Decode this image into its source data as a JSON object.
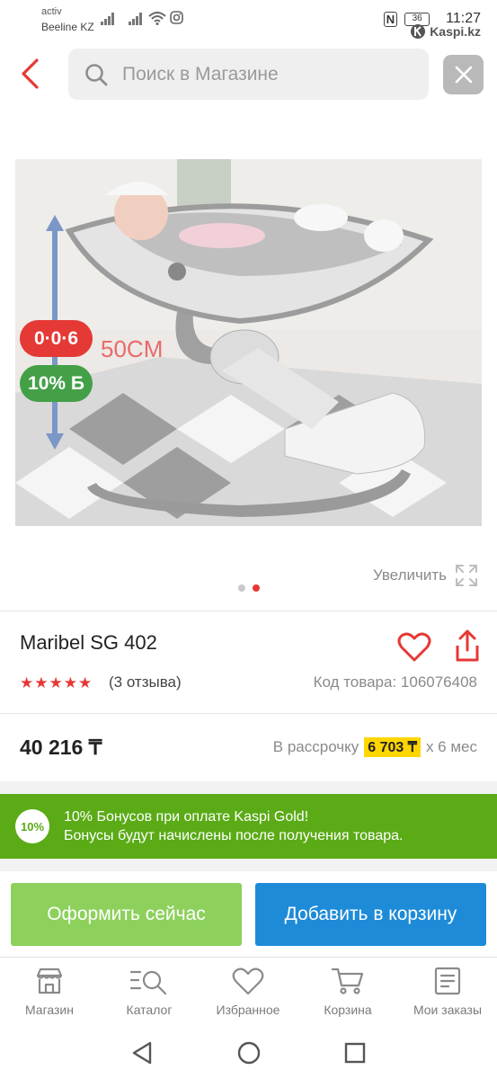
{
  "status_bar": {
    "carrier_line1": "activ",
    "carrier_line2": "Beeline KZ",
    "nfc": "N",
    "battery": "36",
    "time": "11:27",
    "watermark": "Kaspi.kz"
  },
  "search": {
    "placeholder": "Поиск в Магазине"
  },
  "product": {
    "badge_installment": "0·0·6",
    "badge_bonus": "10% Б",
    "image_text": "50CM",
    "zoom_label": "Увеличить",
    "slides_total": 2,
    "slide_active": 2,
    "title": "Maribel SG 402",
    "rating": 5,
    "reviews": "(3 отзыва)",
    "code": "Код товара: 106076408",
    "price": "40 216 ₸",
    "installment_prefix": "В рассрочку",
    "installment_amount": "6 703 ₸",
    "installment_suffix": "х 6 мес"
  },
  "bonus_banner": {
    "circle": "10%",
    "line1": "10% Бонусов при оплате Kaspi Gold!",
    "line2": "Бонусы будут начислены после получения товара."
  },
  "actions": {
    "buy_now": "Оформить сейчас",
    "add_to_cart": "Добавить в корзину"
  },
  "bottom_nav": [
    {
      "label": "Магазин",
      "icon": "shop-icon"
    },
    {
      "label": "Каталог",
      "icon": "catalog-icon"
    },
    {
      "label": "Избранное",
      "icon": "heart-icon"
    },
    {
      "label": "Корзина",
      "icon": "cart-icon"
    },
    {
      "label": "Мои заказы",
      "icon": "orders-icon"
    }
  ],
  "colors": {
    "accent_red": "#e53935",
    "green": "#5aab16",
    "blue": "#1e8bd8",
    "yellow": "#ffd600"
  }
}
